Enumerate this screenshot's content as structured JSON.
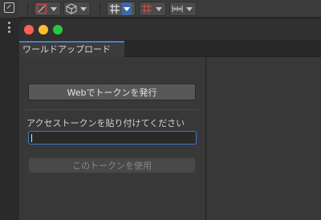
{
  "toolbar": {
    "icons": [
      "scene-view-icon",
      "gizmo-icon",
      "box-icon",
      "grid-snap-icon",
      "increment-snap-icon",
      "ruler-icon"
    ],
    "colors": {
      "active_caret": "#3d6aa6"
    }
  },
  "window": {
    "tab_label": "ワールドアップロード",
    "issue_token_button": "Webでトークンを発行",
    "paste_label": "アクセストークンを貼り付けてください",
    "token_value": "",
    "use_token_button": "このトークンを使用"
  },
  "traffic_lights": {
    "close": "#fe5f57",
    "minimize": "#febc2e",
    "maximize": "#28c840"
  }
}
